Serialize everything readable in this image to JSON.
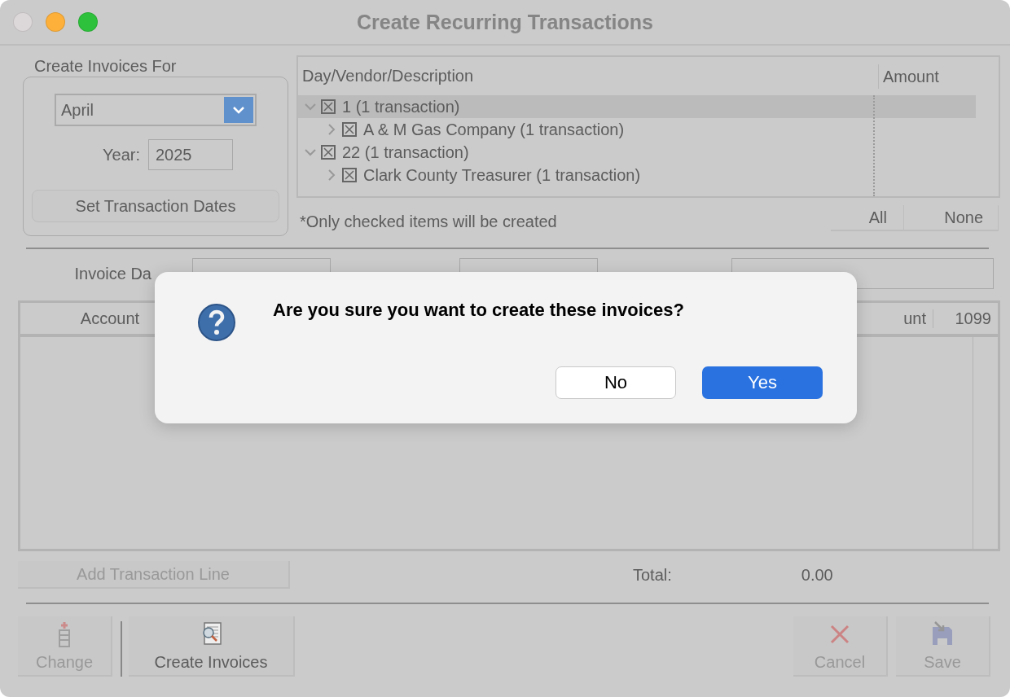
{
  "window": {
    "title": "Create Recurring Transactions"
  },
  "period": {
    "label": "Create Invoices For",
    "month": "April",
    "year_label": "Year:",
    "year": "2025",
    "button": "Set Transaction Dates"
  },
  "tree": {
    "columns": [
      "Day/Vendor/Description",
      "Amount"
    ],
    "items": [
      {
        "label": "1 (1 transaction)",
        "checked": true,
        "expanded": true,
        "selected": true,
        "children": [
          {
            "label": "A & M Gas Company (1 transaction)",
            "checked": true,
            "expanded": false,
            "selected": false
          }
        ]
      },
      {
        "label": "22 (1 transaction)",
        "checked": true,
        "expanded": true,
        "selected": false,
        "children": [
          {
            "label": "Clark County Treasurer (1 transaction)",
            "checked": true,
            "expanded": false,
            "selected": false
          }
        ]
      }
    ]
  },
  "note": "*Only checked items will be created",
  "select_buttons": [
    "All",
    "None"
  ],
  "invoice_fields": {
    "invoice_date_label": "Invoice Da"
  },
  "grid": {
    "columns": [
      "Account",
      "unt",
      "1099"
    ]
  },
  "add_line": {
    "label": "Add Transaction Line",
    "disabled": true
  },
  "total": {
    "label": "Total:",
    "value": "0.00"
  },
  "toolbar": [
    {
      "kind": "change",
      "label": "Change",
      "disabled": true
    },
    {
      "kind": "create",
      "label": "Create Invoices",
      "disabled": false
    },
    {
      "kind": "cancel",
      "label": "Cancel",
      "disabled": true
    },
    {
      "kind": "save",
      "label": "Save",
      "disabled": true
    }
  ],
  "dialog": {
    "message": "Are you sure you want to create these invoices?",
    "buttons": [
      {
        "label": "No",
        "default": false
      },
      {
        "label": "Yes",
        "default": true
      }
    ]
  }
}
